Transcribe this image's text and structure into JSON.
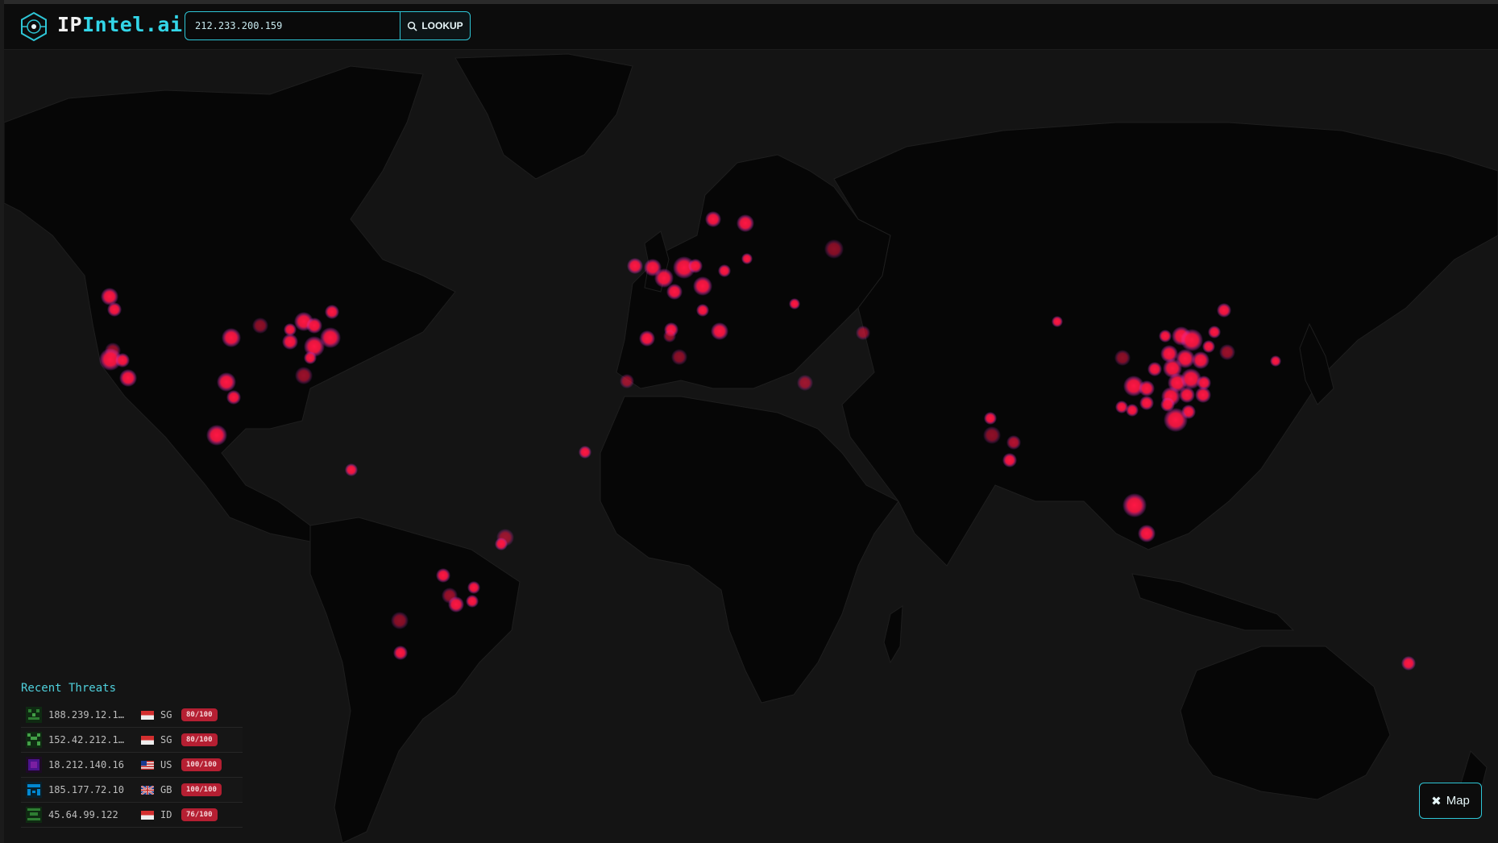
{
  "app": {
    "brand_prefix": "IP",
    "brand_suffix": "Intel.ai",
    "accent_color": "#2ec6d6"
  },
  "search": {
    "value": "212.233.200.159",
    "button_label": "LOOKUP",
    "icon": "search-icon"
  },
  "map": {
    "background_color": "#0f0f10",
    "land_color": "#050505",
    "marker_color": "#ff1744",
    "marker_glow_color": "#e040fb"
  },
  "recent_threats": {
    "title": "Recent Threats",
    "items": [
      {
        "ip": "188.239.12.1…",
        "country": "SG",
        "score": "80/100",
        "avatar_color": "#2e7d32"
      },
      {
        "ip": "152.42.212.1…",
        "country": "SG",
        "score": "80/100",
        "avatar_color": "#43a047"
      },
      {
        "ip": "18.212.140.16",
        "country": "US",
        "score": "100/100",
        "avatar_color": "#7b1fa2"
      },
      {
        "ip": "185.177.72.10",
        "country": "GB",
        "score": "100/100",
        "avatar_color": "#0288d1"
      },
      {
        "ip": "45.64.99.122",
        "country": "ID",
        "score": "76/100",
        "avatar_color": "#2e7d32"
      }
    ]
  },
  "map_toggle": {
    "label": "Map",
    "icon": "close-icon"
  }
}
